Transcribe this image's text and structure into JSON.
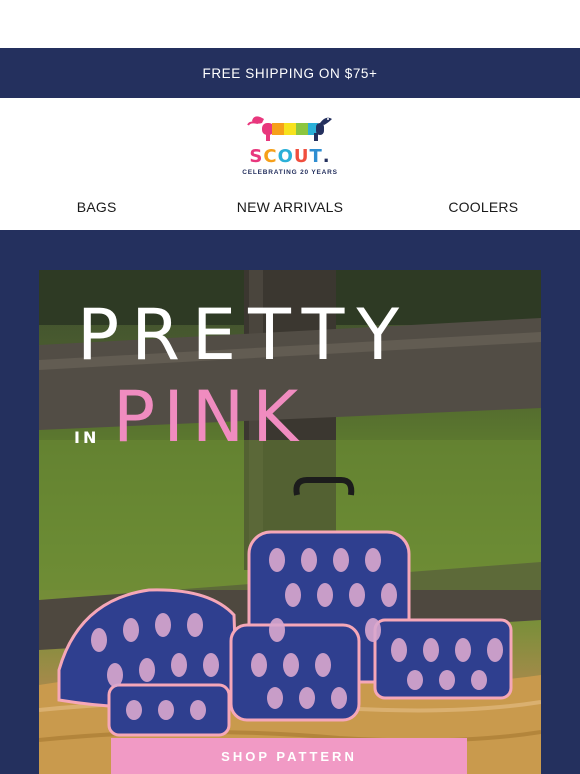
{
  "promo": {
    "text": "FREE SHIPPING ON $75+"
  },
  "brand": {
    "logo_letters": [
      "S",
      "C",
      "O",
      "U",
      "T",
      "."
    ],
    "logo_colors": [
      "#e8377d",
      "#f6a01a",
      "#2bb0d8",
      "#f04e3e",
      "#2e8dd1",
      "#24305e"
    ],
    "tagline": "CELEBRATING 20 YEARS",
    "icon": "dachshund-logo-icon"
  },
  "nav": {
    "items": [
      {
        "label": "BAGS"
      },
      {
        "label": "NEW ARRIVALS"
      },
      {
        "label": "COOLERS"
      }
    ]
  },
  "hero": {
    "headline_line1": "PRETTY",
    "headline_in": "IN",
    "headline_line2": "PINK",
    "cta_label": "SHOP PATTERN"
  },
  "colors": {
    "navy": "#24305e",
    "pink": "#f19ac5",
    "headline_pink": "#f08cc0"
  }
}
